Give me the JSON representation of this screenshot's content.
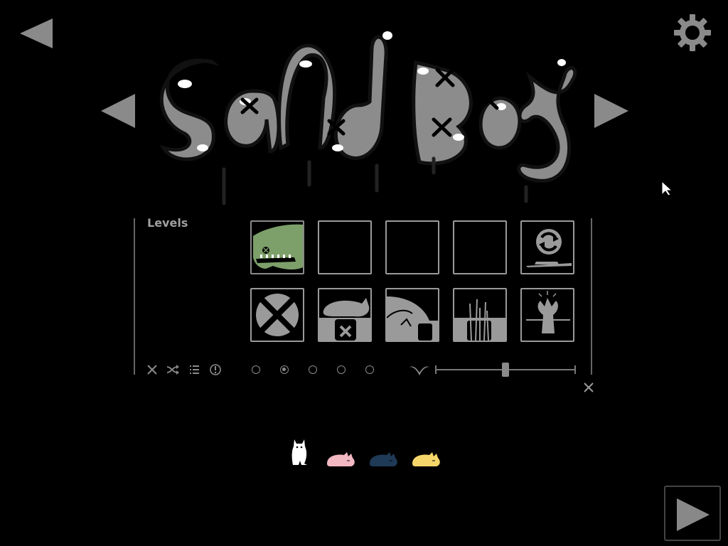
{
  "panel": {
    "levels_label": "Levels"
  },
  "logo": {
    "text": "SandBox"
  },
  "level_grid": {
    "rows": [
      [
        "dino",
        "empty",
        "empty",
        "empty",
        "reset"
      ],
      [
        "delete",
        "cat-cross",
        "cat-slope",
        "grass",
        "tree"
      ]
    ],
    "selected": "dino"
  },
  "toolbar": {
    "icons": [
      "close-icon",
      "shuffle-icon",
      "list-icon",
      "info-icon"
    ],
    "pager_count": 5,
    "pager_active": 2,
    "slider_value": 0.5
  },
  "characters": [
    "white-cat",
    "pink-cat",
    "navy-cat",
    "yellow-cat"
  ],
  "colors": {
    "background": "#000000",
    "ui_gray": "#9a9a9a",
    "dino_green": "#7da06a",
    "pink_cat": "#f2b8c2",
    "navy_cat": "#1f3a56",
    "yellow_cat": "#f5d66a"
  }
}
